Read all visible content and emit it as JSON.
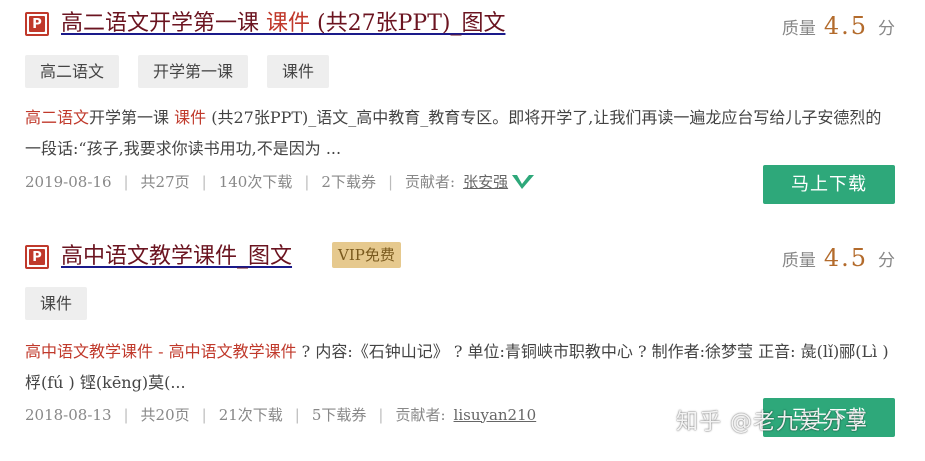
{
  "results": [
    {
      "icon": "ppt-file-icon",
      "icon_letter": "P",
      "title_part1": "高二语文开学第一课 ",
      "title_part2": "课件",
      "title_part3": " (共27张PPT)_图文",
      "quality_label": "质量",
      "quality_score": "4.5",
      "quality_unit": "分",
      "tags": [
        "高二语文",
        "开学第一课",
        "课件"
      ],
      "summary_hl1": "高二语文",
      "summary_t1": "开学第一课 ",
      "summary_hl2": "课件",
      "summary_t2": " (共27张PPT)_语文_高中教育_教育专区。即将开学了,让我们再读一遍龙应台写给儿子安德烈的一段话:“孩子,我要求你读书用功,不是因为 ...",
      "date": "2019-08-16",
      "pages": "共27页",
      "downloads": "140次下载",
      "coupons": "2下载券",
      "contributor_label": "贡献者:",
      "contributor": "张安强",
      "verified_icon": "verified-check-icon",
      "download_label": "马上下载",
      "accent": "#2ea87a"
    },
    {
      "icon": "ppt-file-icon",
      "icon_letter": "P",
      "title": "高中语文教学课件_图文 ",
      "badge": "VIP免费",
      "quality_label": "质量",
      "quality_score": "4.5",
      "quality_unit": "分",
      "tags": [
        "课件"
      ],
      "summary_hl": "高中语文教学课件 - 高中语文教学课件",
      "summary_t": " ? 内容:《石钟山记》 ? 单位:青铜峡市职教中心 ? 制作者:徐梦莹 正音: 彘(lǐ)郦(Lì )桴(fú ) 铿(kēng)莫(...",
      "date": "2018-08-13",
      "pages": "共20页",
      "downloads": "21次下载",
      "coupons": "5下载券",
      "contributor_label": "贡献者:",
      "contributor": "lisuyan210",
      "download_label": "马上下载"
    }
  ],
  "watermark": "知乎 @老九爱分享"
}
